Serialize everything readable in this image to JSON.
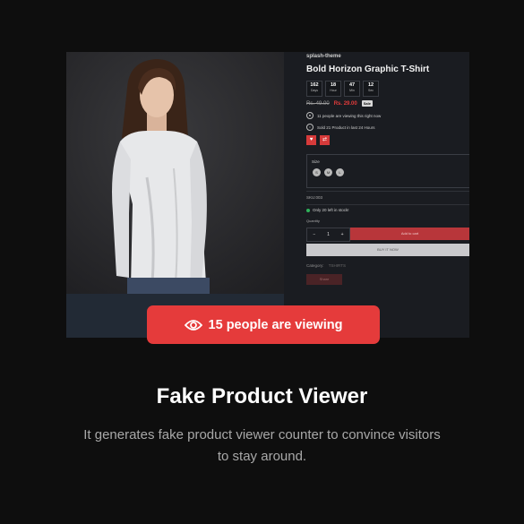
{
  "product": {
    "brand": "splash-theme",
    "title": "Bold Horizon Graphic T-Shirt",
    "countdown": [
      {
        "value": "162",
        "label": "Days"
      },
      {
        "value": "18",
        "label": "Hour"
      },
      {
        "value": "47",
        "label": "Min"
      },
      {
        "value": "12",
        "label": "Sec"
      }
    ],
    "old_price": "Rs. 49.00",
    "new_price": "Rs. 29.00",
    "sale_badge": "Sale",
    "viewing_info": "11 people are viewing this right now",
    "sold_info": "Sold 21 Product in last 24 Hours",
    "size_label": "Size",
    "sizes": [
      "S",
      "M",
      "L"
    ],
    "sku": "SKU:003",
    "stock": "Only 20 left in stock!",
    "quantity_label": "Quantity",
    "quantity_minus": "−",
    "quantity_value": "1",
    "quantity_plus": "+",
    "add_to_cart": "Add to cart",
    "buy_now": "BUY IT NOW",
    "category_label": "Category:",
    "category_value": "TSHIRTS",
    "ghost_button": "Share",
    "wishlist_icon": "heart-icon",
    "compare_icon": "compare-icon"
  },
  "viewer_pill": {
    "text": "15 people are viewing",
    "icon": "eye-icon",
    "color": "#e53b3b"
  },
  "feature": {
    "title": "Fake Product Viewer",
    "description": "It generates fake product viewer counter to convince visitors to stay around."
  }
}
